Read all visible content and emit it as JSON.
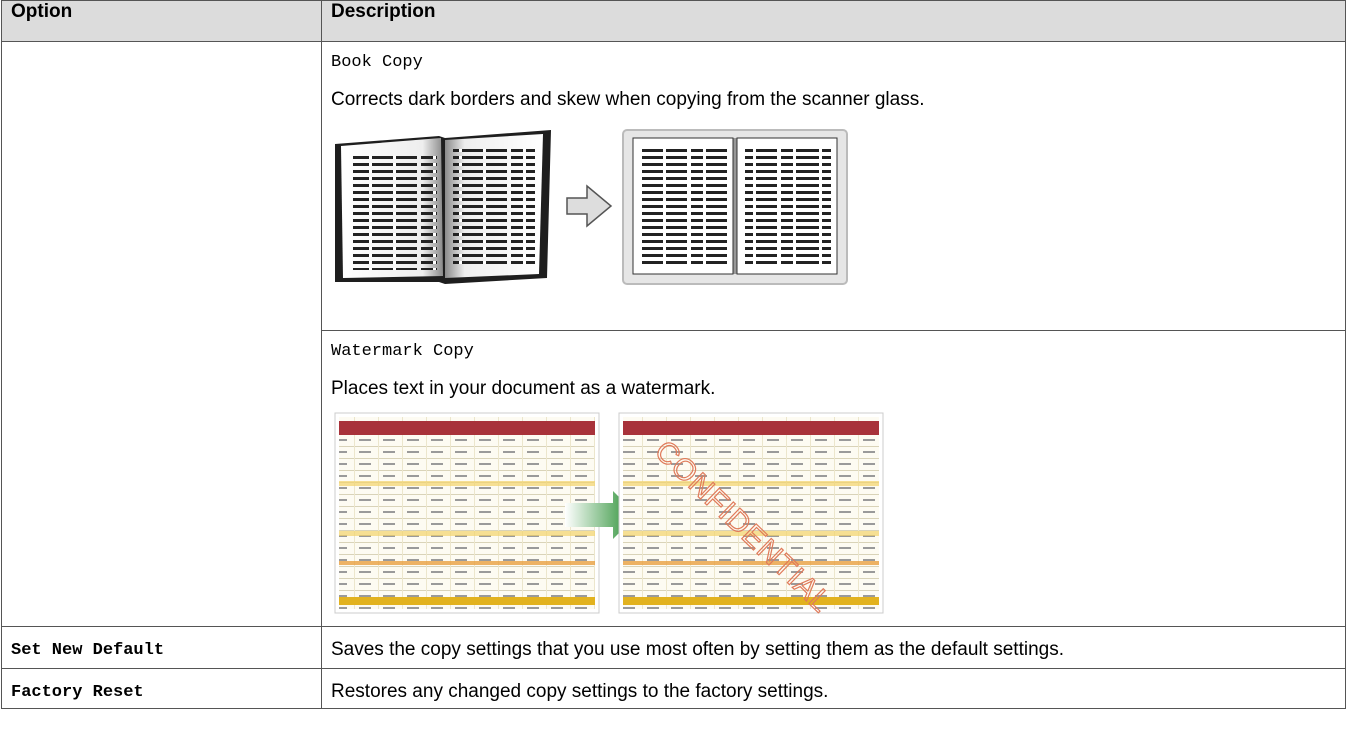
{
  "table": {
    "headers": {
      "option": "Option",
      "description": "Description"
    },
    "book_copy": {
      "name": "Book Copy",
      "text": "Corrects dark borders and skew when copying from the scanner glass."
    },
    "watermark_copy": {
      "name": "Watermark Copy",
      "text": "Places text in your document as a watermark.",
      "watermark_word": "CONFIDENTIAL"
    },
    "rows": [
      {
        "option": "Set New Default",
        "description": "Saves the copy settings that you use most often by setting them as the default settings."
      },
      {
        "option": "Factory Reset",
        "description": "Restores any changed copy settings to the factory settings."
      }
    ]
  },
  "colors": {
    "header_bg": "#dcdcdc",
    "border": "#555555",
    "spreadsheet_header": "#a8323a",
    "spreadsheet_highlight": "#f2d36b",
    "arrow_green": "#2a9a2a",
    "watermark": "#e07a5a"
  }
}
